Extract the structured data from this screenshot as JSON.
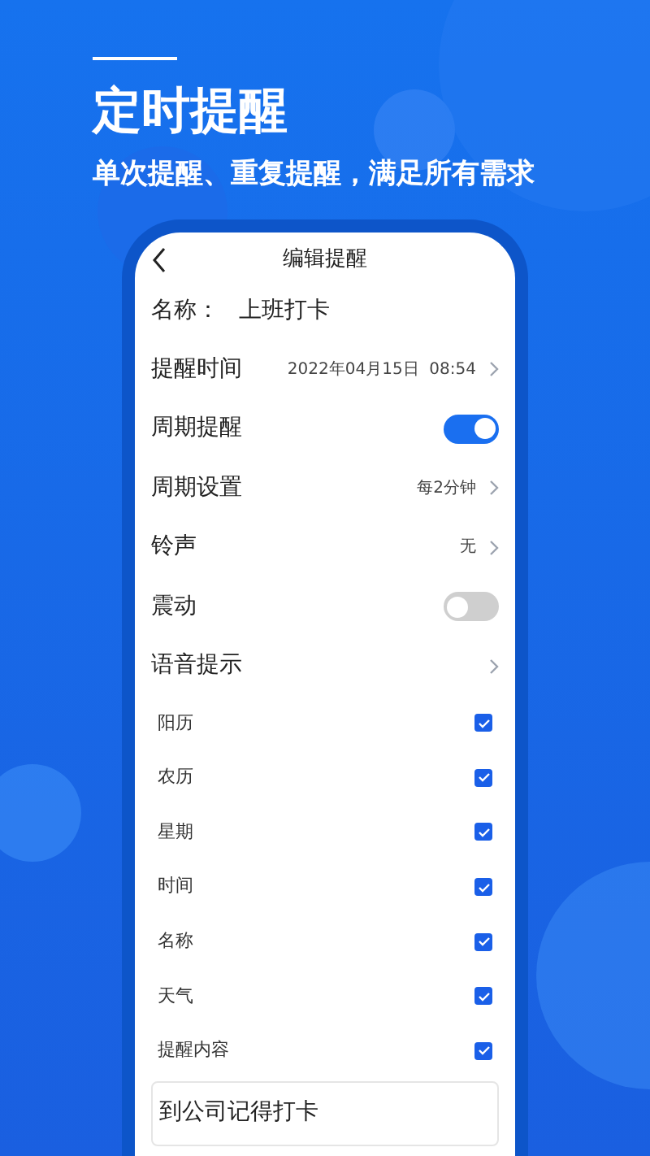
{
  "promo": {
    "title": "定时提醒",
    "subtitle": "单次提醒、重复提醒，满足所有需求"
  },
  "screen": {
    "title": "编辑提醒",
    "name_label": "名称：",
    "name_value": "上班打卡",
    "settings": [
      {
        "kind": "value",
        "label": "提醒时间",
        "value": "2022年04月15日  08:54"
      },
      {
        "kind": "toggle",
        "label": "周期提醒",
        "on": true
      },
      {
        "kind": "value",
        "label": "周期设置",
        "value": "每2分钟"
      },
      {
        "kind": "value",
        "label": "铃声",
        "value": "无"
      },
      {
        "kind": "toggle",
        "label": "震动",
        "on": false
      },
      {
        "kind": "link",
        "label": "语音提示"
      }
    ],
    "voice_items": [
      {
        "label": "阳历",
        "checked": true
      },
      {
        "label": "农历",
        "checked": true
      },
      {
        "label": "星期",
        "checked": true
      },
      {
        "label": "时间",
        "checked": true
      },
      {
        "label": "名称",
        "checked": true
      },
      {
        "label": "天气",
        "checked": true
      },
      {
        "label": "提醒内容",
        "checked": true
      }
    ],
    "content_field": {
      "value": "到公司记得打卡"
    }
  }
}
